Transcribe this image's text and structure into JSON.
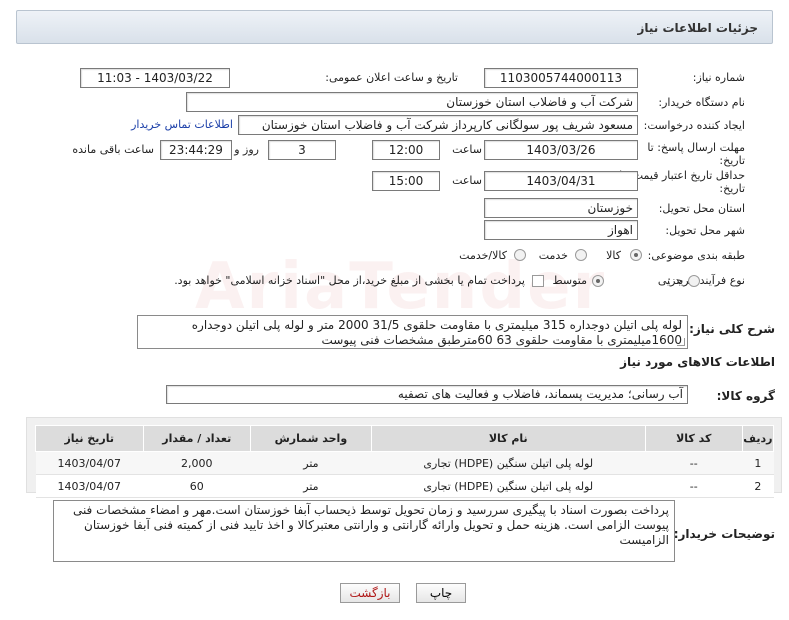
{
  "panel": {
    "title": "جزئیات اطلاعات نیاز"
  },
  "form": {
    "need_number_label": "شماره نیاز:",
    "need_number": "1103005744000113",
    "announce_label": "تاریخ و ساعت اعلان عمومی:",
    "announce_value": "1403/03/22 - 11:03",
    "buyer_org_label": "نام دستگاه خریدار:",
    "buyer_org": "شرکت آب و فاضلاب استان خوزستان",
    "requester_label": "ایجاد کننده درخواست:",
    "requester": "مسعود شریف پور سولگانی کارپرداز شرکت آب و فاضلاب استان خوزستان",
    "contact_link": "اطلاعات تماس خریدار",
    "reply_deadline_label_1": "مهلت ارسال پاسخ: تا",
    "reply_deadline_label_2": "تاریخ:",
    "reply_date": "1403/03/26",
    "time_label": "ساعت",
    "reply_time": "12:00",
    "days_value": "3",
    "days_label": "روز و",
    "remaining_time": "23:44:29",
    "remaining_label": "ساعت باقی مانده",
    "price_validity_label_1": "حداقل تاریخ اعتبار قیمت: تا",
    "price_validity_label_2": "تاریخ:",
    "price_date": "1403/04/31",
    "price_time": "15:00",
    "province_label": "استان محل تحویل:",
    "province": "خوزستان",
    "city_label": "شهر محل تحویل:",
    "city": "اهواز",
    "category_label": "طبقه بندی موضوعی:",
    "category_options": [
      "کالا",
      "خدمت",
      "کالا/خدمت"
    ],
    "process_label": "نوع فرآیند خرید :",
    "process_options": [
      "جزیی",
      "متوسط"
    ],
    "process_note": "پرداخت تمام یا بخشی از مبلغ خرید،از محل \"اسناد خزانه اسلامی\" خواهد بود."
  },
  "summary": {
    "label": "شرح کلی نیاز:",
    "text": "لوله پلی اتیلن دوجداره 315 میلیمتری با مقاومت حلقوی 31/5 2000 متر و لوله پلی اتیلن دوجداره 1600میلیمتری با مقاومت حلقوی 63   60مترطبق مشخصات فنی پیوست"
  },
  "goods": {
    "header": "اطلاعات کالاهای مورد نیاز",
    "group_label": "گروه کالا:",
    "group_value": "آب رسانی؛ مدیریت پسماند، فاضلاب و فعالیت های تصفیه",
    "columns": [
      "ردیف",
      "کد کالا",
      "نام کالا",
      "واحد شمارش",
      "تعداد / مقدار",
      "تاریخ نیاز"
    ],
    "rows": [
      {
        "idx": "1",
        "code": "--",
        "name": "لوله پلی اتیلن سنگین (HDPE) تجاری",
        "unit": "متر",
        "qty": "2,000",
        "date": "1403/04/07"
      },
      {
        "idx": "2",
        "code": "--",
        "name": "لوله پلی اتیلن سنگین (HDPE) تجاری",
        "unit": "متر",
        "qty": "60",
        "date": "1403/04/07"
      }
    ]
  },
  "buyer_notes": {
    "label": "توضیحات خریدار:",
    "text": "پرداخت بصورت اسناد با پیگیری  سررسید و زمان تحویل توسط ذیحساب آبفا خوزستان است.مهر و امضاء مشخصات فنی پیوست الزامی است. هزینه حمل و تحویل وارائه گارانتی و وارانتی معتبرکالا و اخذ تایید فنی از کمیته فنی آبفا خوزستان الزامیست"
  },
  "buttons": {
    "print": "چاپ",
    "back": "بازگشت"
  },
  "colors": {
    "link": "#1a3ea8",
    "back_text": "#b01818",
    "header_bg": "#dcdcdc"
  }
}
